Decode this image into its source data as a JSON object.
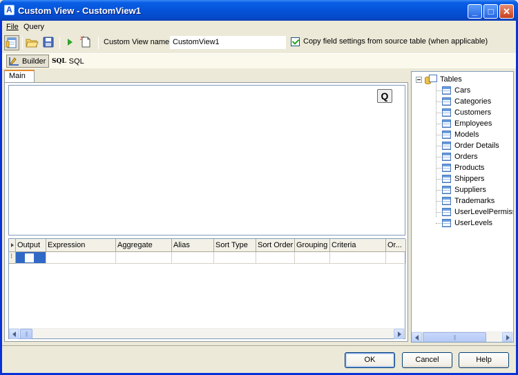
{
  "window": {
    "title": "Custom View - CustomView1",
    "controls": {
      "minimize": "_",
      "maximize": "□",
      "close": "✕"
    }
  },
  "menubar": {
    "items": [
      "File",
      "Query"
    ]
  },
  "toolbar": {
    "custom_view_name_label": "Custom View name",
    "custom_view_name_value": "CustomView1",
    "copy_field_settings_label": "Copy field settings from source table (when applicable)",
    "copy_field_settings_checked": true,
    "icons": [
      "query-builder-icon",
      "open-folder-icon",
      "save-icon",
      "run-icon",
      "new-document-icon"
    ]
  },
  "modes": {
    "builder_label": "Builder",
    "sql_badge": "SQL",
    "sql_label": "SQL"
  },
  "tabs": {
    "main_label": "Main"
  },
  "design": {
    "q_button": "Q"
  },
  "grid": {
    "columns": [
      "Output",
      "Expression",
      "Aggregate",
      "Alias",
      "Sort Type",
      "Sort Order",
      "Grouping",
      "Criteria",
      "Or..."
    ],
    "rows": [
      {
        "output": false,
        "expression": "",
        "aggregate": "",
        "alias": "",
        "sort_type": "",
        "sort_order": "",
        "grouping": "",
        "criteria": "",
        "or": ""
      }
    ]
  },
  "tree": {
    "root_label": "Tables",
    "items": [
      "Cars",
      "Categories",
      "Customers",
      "Employees",
      "Models",
      "Order Details",
      "Orders",
      "Products",
      "Shippers",
      "Suppliers",
      "Trademarks",
      "UserLevelPermissions",
      "UserLevels"
    ]
  },
  "buttons": {
    "ok": "OK",
    "cancel": "Cancel",
    "help": "Help"
  },
  "colors": {
    "titlebar": "#0553d8",
    "window_frame": "#0831d9",
    "face": "#ece9d8",
    "selection": "#316ac5",
    "tab_accent": "#e68b2c"
  }
}
